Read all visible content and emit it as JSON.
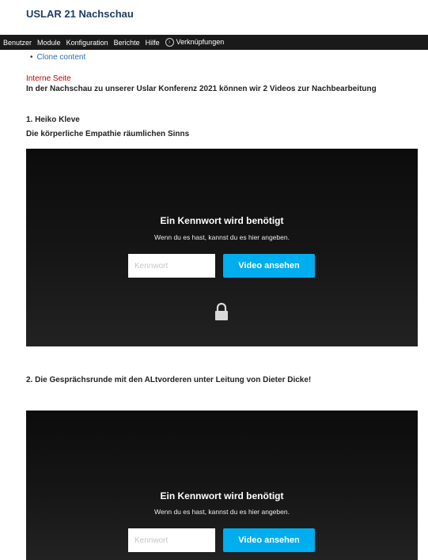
{
  "page": {
    "title": "USLAR 21 Nachschau"
  },
  "toolbar": {
    "items": [
      "Benutzer",
      "Module",
      "Konfiguration",
      "Berichte",
      "Hilfe"
    ],
    "links_icon": "circle-arrow-icon",
    "links_label": "Verknüpfungen",
    "background": "#1a1a1a"
  },
  "content": {
    "clone_link": "Clone content",
    "internal_label": "Interne Seite",
    "intro": "In der Nachschau zu unserer Uslar Konferenz 2021 können wir 2 Videos zur Nachbearbeitung",
    "video1_heading": "1. Heiko Kleve",
    "video1_subheading": "Die körperliche Empathie räumlichen Sinns",
    "video2_heading": "2. Die Gesprächsrunde mit den ALtvorderen unter Leitung von Dieter Dicke!"
  },
  "player": {
    "title": "Ein Kennwort wird benötigt",
    "subtitle": "Wenn du es hast, kannst du es hier angeben.",
    "password_placeholder": "Kennwort",
    "button": "Video ansehen",
    "button_color": "#00adef",
    "lock_icon": "lock-icon"
  }
}
